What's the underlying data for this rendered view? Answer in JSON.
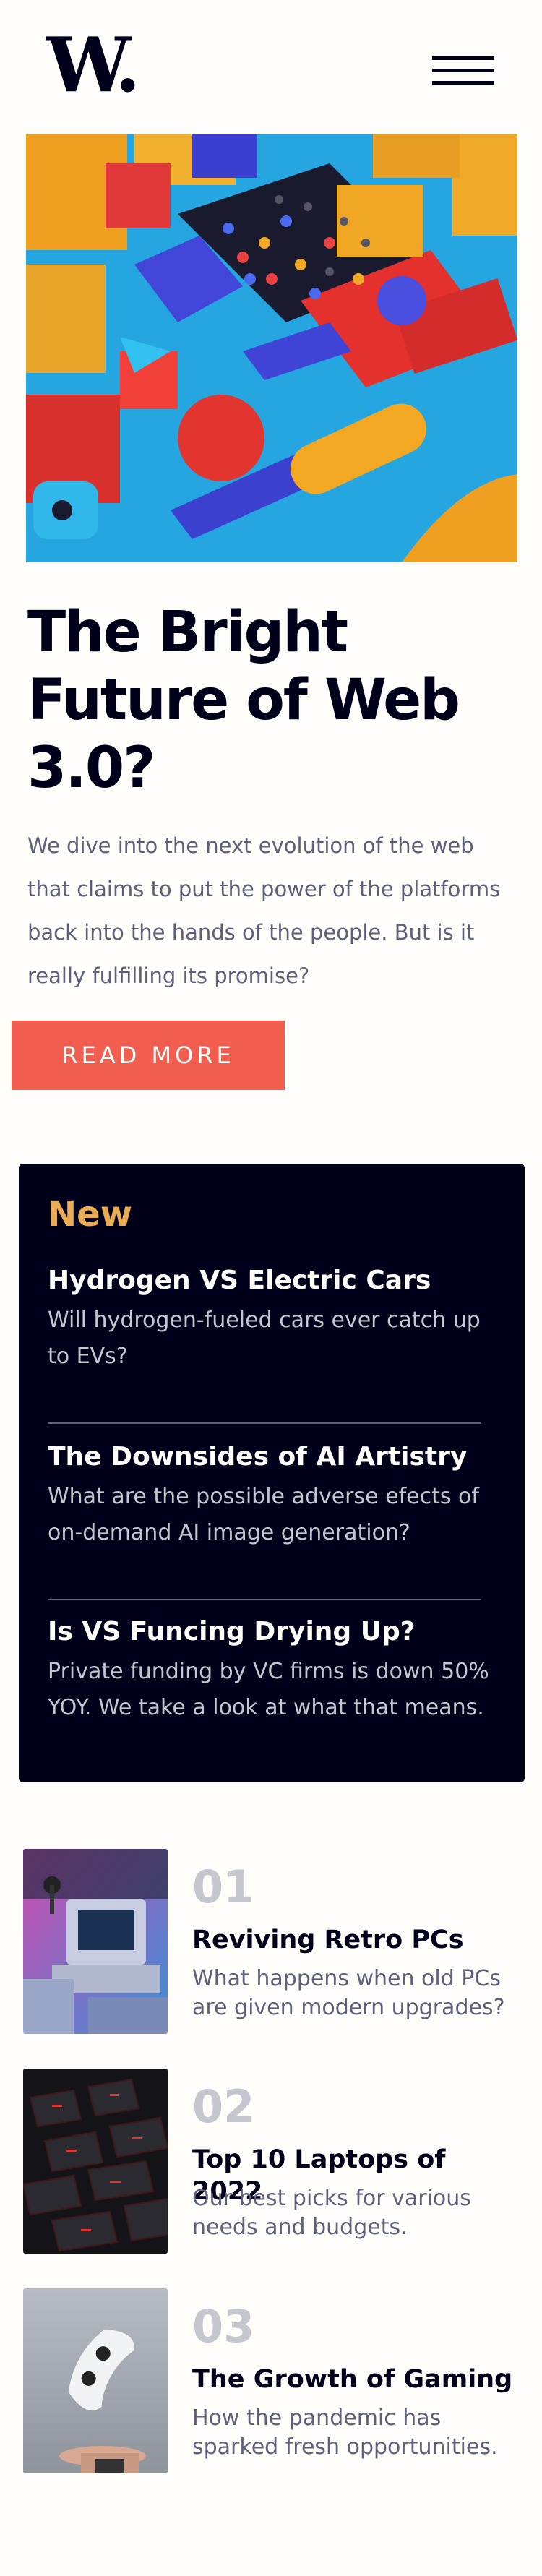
{
  "header": {
    "logo": "W.",
    "menu_icon": "hamburger-menu-icon"
  },
  "hero": {
    "image_icon": "abstract-3d-shapes-image",
    "title": "The Bright Future of Web 3.0?",
    "description": "We dive into the next evolution of the web that claims to put the power of the platforms back into the hands of the people. But is it really fulfilling its promise?",
    "button_label": "READ MORE"
  },
  "new_section": {
    "heading": "New",
    "items": [
      {
        "title": "Hydrogen VS Electric Cars",
        "description": "Will hydrogen-fueled cars ever catch up to EVs?"
      },
      {
        "title": "The Downsides of AI Artistry",
        "description": "What are the possible adverse efects of on-demand AI image generation?"
      },
      {
        "title": "Is VS Funcing Drying Up?",
        "description": "Private funding by VC firms is down 50% YOY. We take a look at what that means."
      }
    ]
  },
  "list": {
    "items": [
      {
        "number": "01",
        "title": "Reviving Retro PCs",
        "description": "What happens when old PCs are given modern upgrades?",
        "image": "retro-pc-image"
      },
      {
        "number": "02",
        "title": "Top 10 Laptops of 2022",
        "description": "Our best picks for various needs and budgets.",
        "image": "laptop-keyboard-image"
      },
      {
        "number": "03",
        "title": "The Growth of Gaming",
        "description": "How the pandemic has sparked fresh opportunities.",
        "image": "game-controller-image"
      }
    ]
  },
  "colors": {
    "background": "#fffdfa",
    "dark": "#00001a",
    "accent_red": "#f15e50",
    "accent_orange": "#e9ab53",
    "muted": "#5e607a",
    "light_gray": "#c5c6ce"
  }
}
